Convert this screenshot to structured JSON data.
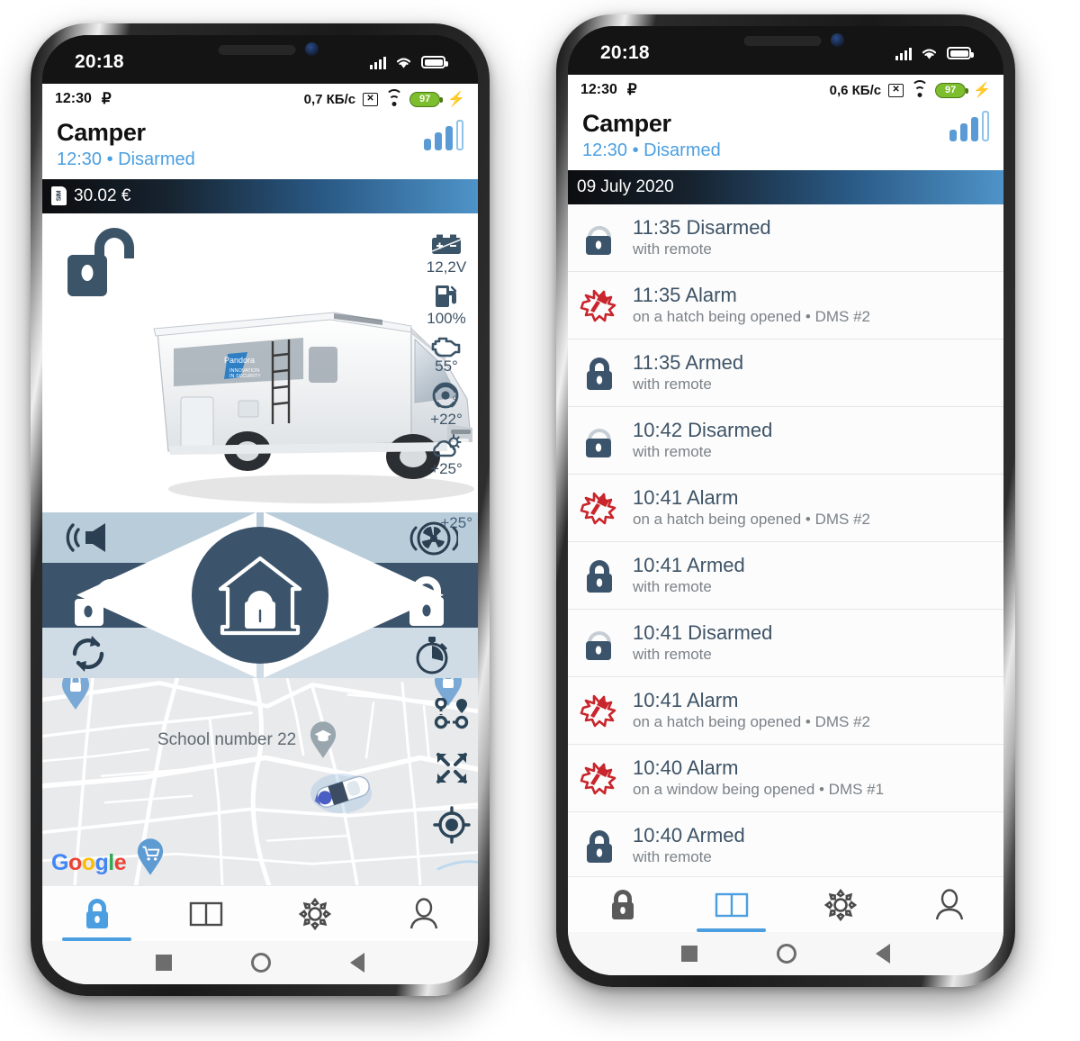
{
  "phones": {
    "left": {
      "os_status": {
        "clock": "20:18"
      },
      "android_status": {
        "time": "12:30",
        "ruble": "₽",
        "speed": "0,7 КБ/c",
        "battery": "97"
      },
      "app_header": {
        "title": "Camper",
        "subtitle": "12:30 • Disarmed"
      },
      "balance_bar": {
        "sim_label": "SIM",
        "value": "30.02 €"
      },
      "sensors": [
        {
          "icon": "battery-icon",
          "value": "12,2V"
        },
        {
          "icon": "fuel-icon",
          "value": "100%"
        },
        {
          "icon": "engine-icon",
          "value": "55°"
        },
        {
          "icon": "cabin-icon",
          "value": "+22°"
        },
        {
          "icon": "weather-icon",
          "value": "+25°"
        }
      ],
      "hub": {
        "top_left": "siren-icon",
        "top_right": "turbine-icon",
        "mid_left": "unlock-icon",
        "mid_right": "lock-icon",
        "bottom_left": "refresh-icon",
        "bottom_right": "timer-icon",
        "center": "garage-lock-icon",
        "temp_badge": "+25°"
      },
      "map": {
        "place_label": "School number 22",
        "google_letters": [
          "G",
          "o",
          "o",
          "g",
          "l",
          "e"
        ],
        "controls": [
          "track-route-icon",
          "fullscreen-icon",
          "locate-icon"
        ]
      },
      "tabs": [
        {
          "name": "tab-security",
          "icon": "lock-icon",
          "active": true
        },
        {
          "name": "tab-journal",
          "icon": "book-icon",
          "active": false
        },
        {
          "name": "tab-settings",
          "icon": "gear-icon",
          "active": false
        },
        {
          "name": "tab-profile",
          "icon": "person-icon",
          "active": false
        }
      ]
    },
    "right": {
      "os_status": {
        "clock": "20:18"
      },
      "android_status": {
        "time": "12:30",
        "ruble": "₽",
        "speed": "0,6 КБ/c",
        "battery": "97"
      },
      "app_header": {
        "title": "Camper",
        "subtitle": "12:30 • Disarmed"
      },
      "date_bar": {
        "date": "09 July 2020"
      },
      "events": [
        {
          "icon": "unlocked-padlock-icon",
          "title": "11:35 Disarmed",
          "detail": "with remote"
        },
        {
          "icon": "alarm-hammer-icon",
          "title": "11:35 Alarm",
          "detail": "on a hatch being opened • DMS #2"
        },
        {
          "icon": "locked-padlock-icon",
          "title": "11:35 Armed",
          "detail": "with remote"
        },
        {
          "icon": "unlocked-padlock-icon",
          "title": "10:42 Disarmed",
          "detail": "with remote"
        },
        {
          "icon": "alarm-hammer-icon",
          "title": "10:41 Alarm",
          "detail": "on a hatch being opened • DMS #2"
        },
        {
          "icon": "locked-padlock-icon",
          "title": "10:41 Armed",
          "detail": "with remote"
        },
        {
          "icon": "unlocked-padlock-icon",
          "title": "10:41 Disarmed",
          "detail": "with remote"
        },
        {
          "icon": "alarm-hammer-icon",
          "title": "10:41 Alarm",
          "detail": "on a hatch being opened • DMS #2"
        },
        {
          "icon": "alarm-hammer-icon",
          "title": "10:40 Alarm",
          "detail": "on a window being opened • DMS #1"
        },
        {
          "icon": "locked-padlock-icon",
          "title": "10:40 Armed",
          "detail": "with remote"
        }
      ],
      "tabs": [
        {
          "name": "tab-security",
          "icon": "lock-icon",
          "active": false
        },
        {
          "name": "tab-journal",
          "icon": "book-icon",
          "active": true
        },
        {
          "name": "tab-settings",
          "icon": "gear-icon",
          "active": false
        },
        {
          "name": "tab-profile",
          "icon": "person-icon",
          "active": false
        }
      ]
    }
  },
  "colors": {
    "accent_blue": "#4b9fe0",
    "dark_slate": "#3c546b",
    "alarm_red": "#c8252c",
    "battery_green": "#7dbe2e"
  }
}
